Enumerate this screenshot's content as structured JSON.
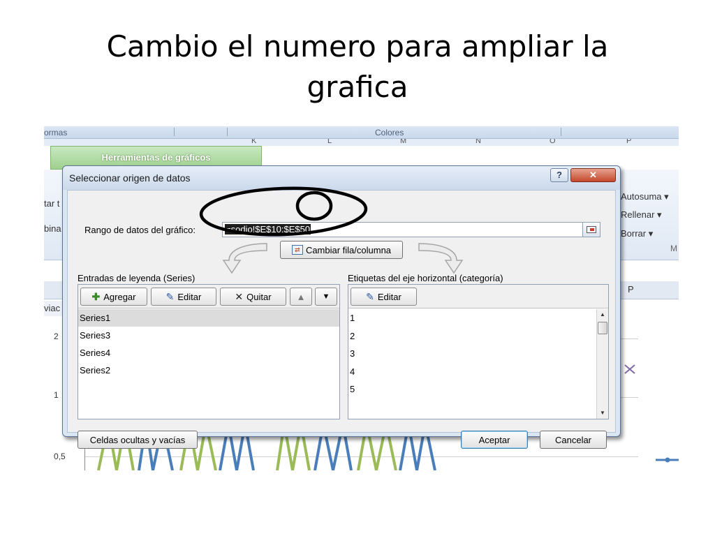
{
  "slide": {
    "title_line1": "Cambio el numero para ampliar la",
    "title_line2": "grafica"
  },
  "excel": {
    "ribbon_top_left": "ormas",
    "ribbon_top_center": "Colores",
    "column_letters": [
      "K",
      "L",
      "M",
      "N",
      "O",
      "P"
    ],
    "chart_tools_tab": "Herramientas de gráficos",
    "ribbon_left_1": "tar t",
    "ribbon_left_2": "bina",
    "ribbon_right_1": "Autosuma ▾",
    "ribbon_right_2": "Rellenar ▾",
    "ribbon_right_3": "Borrar ▾",
    "ribbon_group_m": "M",
    "grid_p": "P",
    "sheet_tab_left": "viac",
    "y_axis_ticks": [
      "2",
      "1",
      "0,5"
    ],
    "colors": {
      "series_blue": "#4a7ebb",
      "series_green": "#9bbb59",
      "series_purple": "#7f6aa6"
    }
  },
  "dialog": {
    "title": "Seleccionar origen de datos",
    "help_button": "?",
    "close_button": "✕",
    "range_label": "Rango de datos del gráfico:",
    "range_value": "=sodio!$E$10:$E$50",
    "switch_button": "Cambiar fila/columna",
    "legend_label": "Entradas de leyenda (Series)",
    "axis_label": "Etiquetas del eje horizontal (categoría)",
    "legend_toolbar": {
      "add": "Agregar",
      "edit": "Editar",
      "remove": "Quitar",
      "up": "▲",
      "down": "▼"
    },
    "axis_toolbar": {
      "edit": "Editar"
    },
    "series": [
      "Series1",
      "Series3",
      "Series4",
      "Series2"
    ],
    "categories": [
      "1",
      "2",
      "3",
      "4",
      "5"
    ],
    "hidden_cells_button": "Celdas ocultas y vacías",
    "ok_button": "Aceptar",
    "cancel_button": "Cancelar"
  }
}
